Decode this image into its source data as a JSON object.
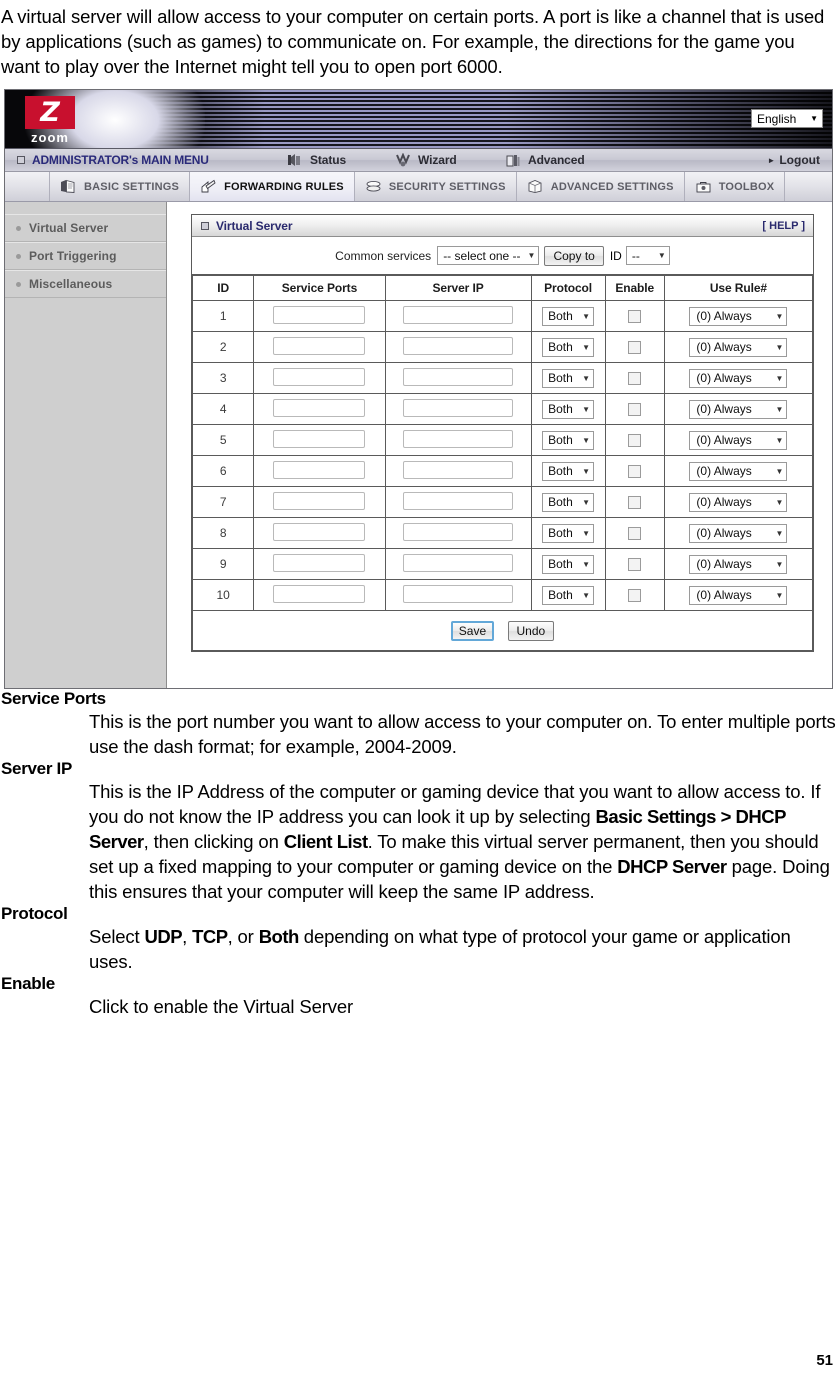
{
  "doc": {
    "intro": "A virtual server will allow access to your computer on certain ports. A port is like a channel that is used by applications (such as games) to communicate on. For example, the directions for the game you want to play over the Internet might tell you to open port 6000.",
    "page_number": "51",
    "sections": [
      {
        "term": "Service Ports",
        "text": "This is the port number you want to allow access to your computer on. To enter multiple ports use the dash format; for example, 2004-2009."
      },
      {
        "term": "Server IP",
        "text": "This is the IP Address of the computer or gaming device that you want to allow access to. If you do not know the IP address you can look it up by selecting Basic Settings > DHCP Server, then clicking on Client List. To make this virtual server permanent, then you should set up a fixed mapping to your computer or gaming device on the DHCP Server page. Doing this ensures that your computer will keep the same IP address."
      },
      {
        "term": "Protocol",
        "text": "Select UDP, TCP, or Both depending on what type of protocol your game or application uses."
      },
      {
        "term": "Enable",
        "text": "Click to enable the Virtual Server"
      }
    ]
  },
  "screenshot": {
    "brand": {
      "mark": "Z",
      "word": "zoom"
    },
    "language": {
      "value": "English",
      "icon": "chevron-down-icon"
    },
    "menubar": {
      "main_menu": "ADMINISTRATOR's MAIN MENU",
      "items": [
        {
          "label": "Status",
          "icon": "status-icon"
        },
        {
          "label": "Wizard",
          "icon": "wizard-icon"
        },
        {
          "label": "Advanced",
          "icon": "advanced-icon"
        }
      ],
      "logout": "Logout"
    },
    "tabs": [
      {
        "label": "BASIC SETTINGS",
        "icon": "book-icon",
        "active": false
      },
      {
        "label": "FORWARDING RULES",
        "icon": "forwarding-icon",
        "active": true
      },
      {
        "label": "SECURITY SETTINGS",
        "icon": "shield-icon",
        "active": false
      },
      {
        "label": "ADVANCED SETTINGS",
        "icon": "cube-icon",
        "active": false
      },
      {
        "label": "TOOLBOX",
        "icon": "toolbox-icon",
        "active": false
      }
    ],
    "sidebar": [
      {
        "label": "Virtual Server"
      },
      {
        "label": "Port Triggering"
      },
      {
        "label": "Miscellaneous"
      }
    ],
    "panel": {
      "title": "Virtual Server",
      "help": "[ HELP ]",
      "common_services_label": "Common services",
      "common_services_value": "-- select one --",
      "copy_to_label": "Copy to",
      "id_label": "ID",
      "id_value": "--",
      "columns": [
        "ID",
        "Service Ports",
        "Server IP",
        "Protocol",
        "Enable",
        "Use Rule#"
      ],
      "rows": [
        {
          "id": "1",
          "service_ports": "",
          "server_ip": "",
          "protocol": "Both",
          "enable": false,
          "rule": "(0) Always"
        },
        {
          "id": "2",
          "service_ports": "",
          "server_ip": "",
          "protocol": "Both",
          "enable": false,
          "rule": "(0) Always"
        },
        {
          "id": "3",
          "service_ports": "",
          "server_ip": "",
          "protocol": "Both",
          "enable": false,
          "rule": "(0) Always"
        },
        {
          "id": "4",
          "service_ports": "",
          "server_ip": "",
          "protocol": "Both",
          "enable": false,
          "rule": "(0) Always"
        },
        {
          "id": "5",
          "service_ports": "",
          "server_ip": "",
          "protocol": "Both",
          "enable": false,
          "rule": "(0) Always"
        },
        {
          "id": "6",
          "service_ports": "",
          "server_ip": "",
          "protocol": "Both",
          "enable": false,
          "rule": "(0) Always"
        },
        {
          "id": "7",
          "service_ports": "",
          "server_ip": "",
          "protocol": "Both",
          "enable": false,
          "rule": "(0) Always"
        },
        {
          "id": "8",
          "service_ports": "",
          "server_ip": "",
          "protocol": "Both",
          "enable": false,
          "rule": "(0) Always"
        },
        {
          "id": "9",
          "service_ports": "",
          "server_ip": "",
          "protocol": "Both",
          "enable": false,
          "rule": "(0) Always"
        },
        {
          "id": "10",
          "service_ports": "",
          "server_ip": "",
          "protocol": "Both",
          "enable": false,
          "rule": "(0) Always"
        }
      ],
      "save_label": "Save",
      "undo_label": "Undo"
    },
    "colors": {
      "brand_red": "#c8102e",
      "link_blue": "#2a2a6e",
      "sidebar_gray": "#cfcfcf",
      "primary_border": "#63a8d8"
    }
  }
}
